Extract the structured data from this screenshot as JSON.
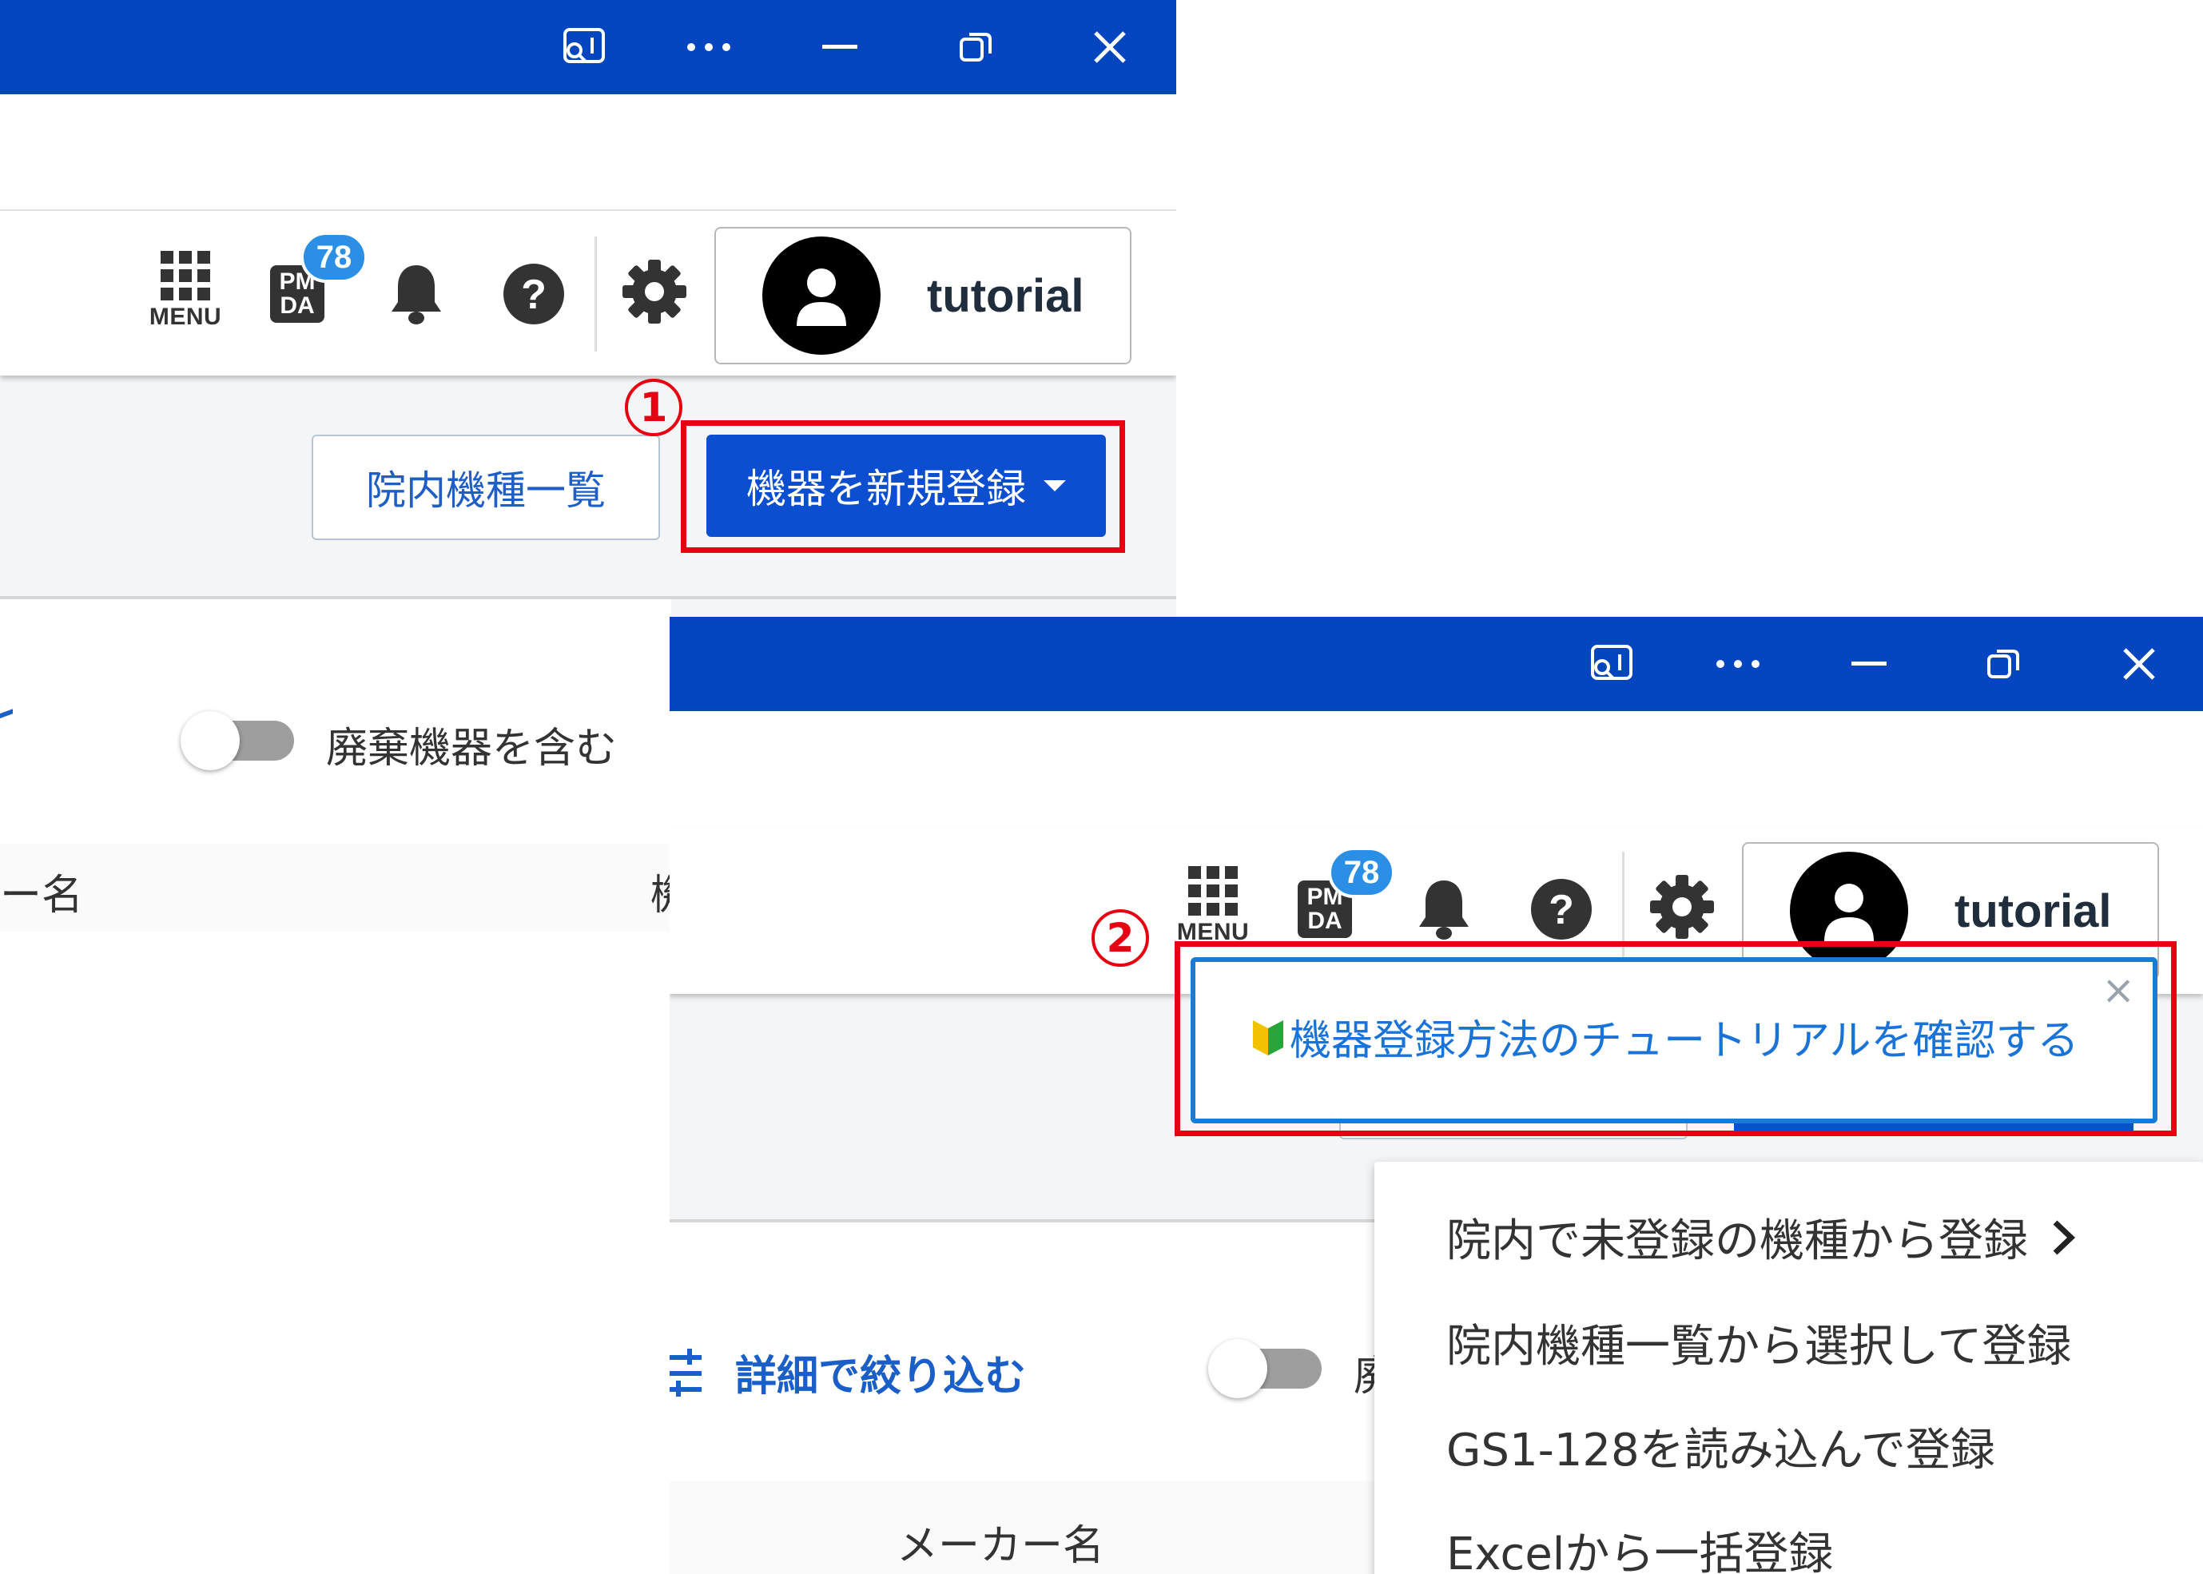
{
  "window_controls": [
    "cast-icon",
    "more-icon",
    "minimize-icon",
    "restore-icon",
    "close-icon"
  ],
  "header": {
    "menu_label": "MENU",
    "pmda_label_line1": "PM",
    "pmda_label_line2": "DA",
    "notification_count": "78",
    "user_name": "tutorial"
  },
  "toolbar": {
    "hospital_model_list": "院内機種一覧",
    "new_register": "機器を新規登録"
  },
  "filters": {
    "include_disposed": "廃棄機器を含む",
    "include_disposed_truncated": "廃",
    "detail_filter": "詳細で絞り込む"
  },
  "table": {
    "maker_col_partial": "ー名",
    "next_col_partial": "機",
    "maker_col": "メーカー名"
  },
  "tooltip": {
    "text": "機器登録方法のチュートリアルを確認する"
  },
  "dropdown": {
    "items": [
      "院内で未登録の機種から登録",
      "院内機種一覧から選択して登録",
      "GS1-128を読み込んで登録",
      "Excelから一括登録"
    ]
  },
  "annotations": {
    "step1": "1",
    "step2": "2"
  },
  "colors": {
    "titlebar": "#0546c0",
    "primary": "#0b4fd0",
    "highlight": "#e60012",
    "link": "#1a73d6",
    "badge": "#2b8fe6"
  }
}
